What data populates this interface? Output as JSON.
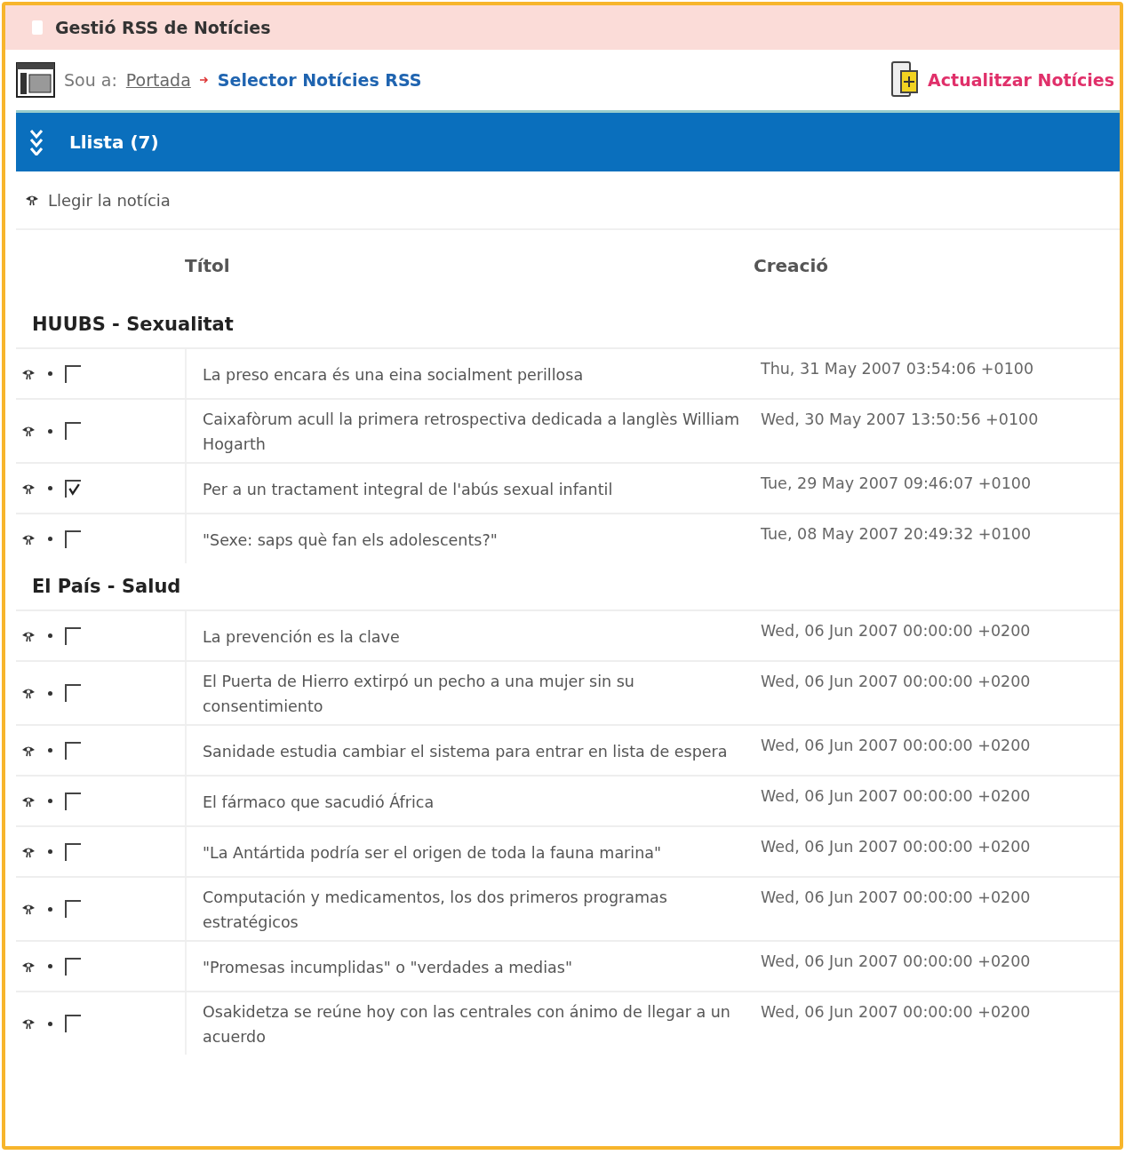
{
  "window": {
    "title": "Gestió RSS de Notícies"
  },
  "breadcrumb": {
    "prefix": "Sou a:",
    "home": "Portada",
    "current": "Selector Notícies RSS"
  },
  "update_action": "Actualitzar Notícies",
  "section": {
    "title": "Llista (7)",
    "expanded": true
  },
  "legend": "Llegir la notícia",
  "table": {
    "columns": [
      "Títol",
      "Creació"
    ],
    "groups": [
      {
        "name": "HUUBS - Sexualitat",
        "rows": [
          {
            "title": "La preso encara és una eina socialment perillosa",
            "date": "Thu, 31 May 2007 03:54:06 +0100",
            "checked": false
          },
          {
            "title": "Caixafòrum acull la primera retrospectiva dedicada a langlès William Hogarth",
            "date": "Wed, 30 May 2007 13:50:56 +0100",
            "checked": false
          },
          {
            "title": "Per a un tractament integral de l'abús sexual infantil",
            "date": "Tue, 29 May 2007 09:46:07 +0100",
            "checked": true
          },
          {
            "title": "\"Sexe: saps què fan els adolescents?\"",
            "date": "Tue, 08 May 2007 20:49:32 +0100",
            "checked": false
          }
        ]
      },
      {
        "name": "El País - Salud",
        "rows": [
          {
            "title": "La prevención es la clave",
            "date": "Wed, 06 Jun 2007 00:00:00 +0200",
            "checked": false
          },
          {
            "title": "El Puerta de Hierro extirpó un pecho a una mujer sin su consentimiento",
            "date": "Wed, 06 Jun 2007 00:00:00 +0200",
            "checked": false
          },
          {
            "title": "Sanidade estudia cambiar el sistema para entrar en lista de espera",
            "date": "Wed, 06 Jun 2007 00:00:00 +0200",
            "checked": false
          },
          {
            "title": "El fármaco que sacudió África",
            "date": "Wed, 06 Jun 2007 00:00:00 +0200",
            "checked": false
          },
          {
            "title": "\"La Antártida podría ser el origen de toda la fauna marina\"",
            "date": "Wed, 06 Jun 2007 00:00:00 +0200",
            "checked": false
          },
          {
            "title": "Computación y medicamentos, los dos primeros programas estratégicos",
            "date": "Wed, 06 Jun 2007 00:00:00 +0200",
            "checked": false
          },
          {
            "title": "\"Promesas incumplidas\" o \"verdades a medias\"",
            "date": "Wed, 06 Jun 2007 00:00:00 +0200",
            "checked": false
          },
          {
            "title": "Osakidetza se reúne hoy con las centrales con ánimo de llegar a un acuerdo",
            "date": "Wed, 06 Jun 2007 00:00:00 +0200",
            "checked": false
          }
        ]
      }
    ]
  }
}
